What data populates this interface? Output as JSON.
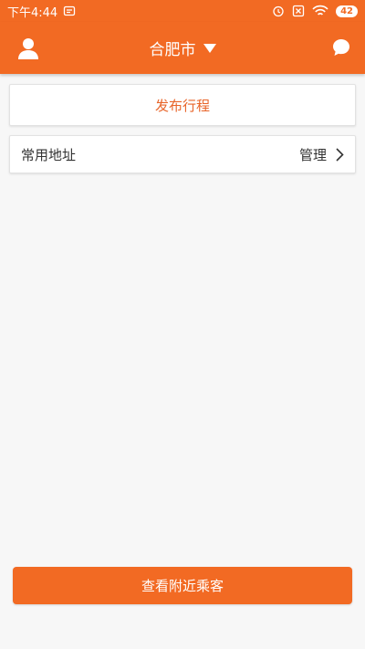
{
  "status_bar": {
    "time": "下午4:44",
    "battery": "42",
    "icons": [
      "notification-icon",
      "alarm-icon",
      "sim-disabled-icon",
      "wifi-icon",
      "battery-icon"
    ]
  },
  "header": {
    "city": "合肥市",
    "left_icon": "user-icon",
    "right_icon": "chat-bubble-icon",
    "caret_icon": "caret-down-icon"
  },
  "publish": {
    "label": "发布行程"
  },
  "address": {
    "label": "常用地址",
    "manage_label": "管理",
    "chevron_icon": "chevron-right-icon"
  },
  "bottom_button": {
    "label": "查看附近乘客"
  },
  "colors": {
    "accent": "#f26a23",
    "accent_text": "#e8652a",
    "background": "#f7f7f7"
  }
}
